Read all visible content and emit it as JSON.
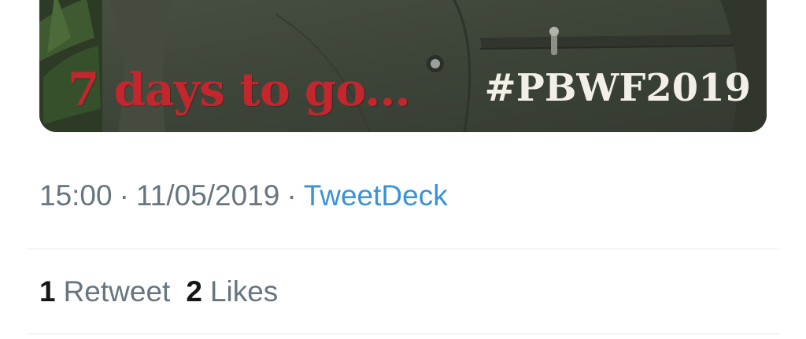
{
  "media": {
    "caption_left": "7 days to go...",
    "caption_right": "#PBWF2019"
  },
  "meta": {
    "time": "15:00",
    "date": "11/05/2019",
    "separator": "·",
    "source": "TweetDeck"
  },
  "stats": {
    "retweets": {
      "count": "1",
      "label": "Retweet"
    },
    "likes": {
      "count": "2",
      "label": "Likes"
    }
  },
  "colors": {
    "caption_red": "#c4262e",
    "link_blue": "#3a92d8",
    "secondary_text": "#66757f",
    "primary_text": "#14171a"
  }
}
